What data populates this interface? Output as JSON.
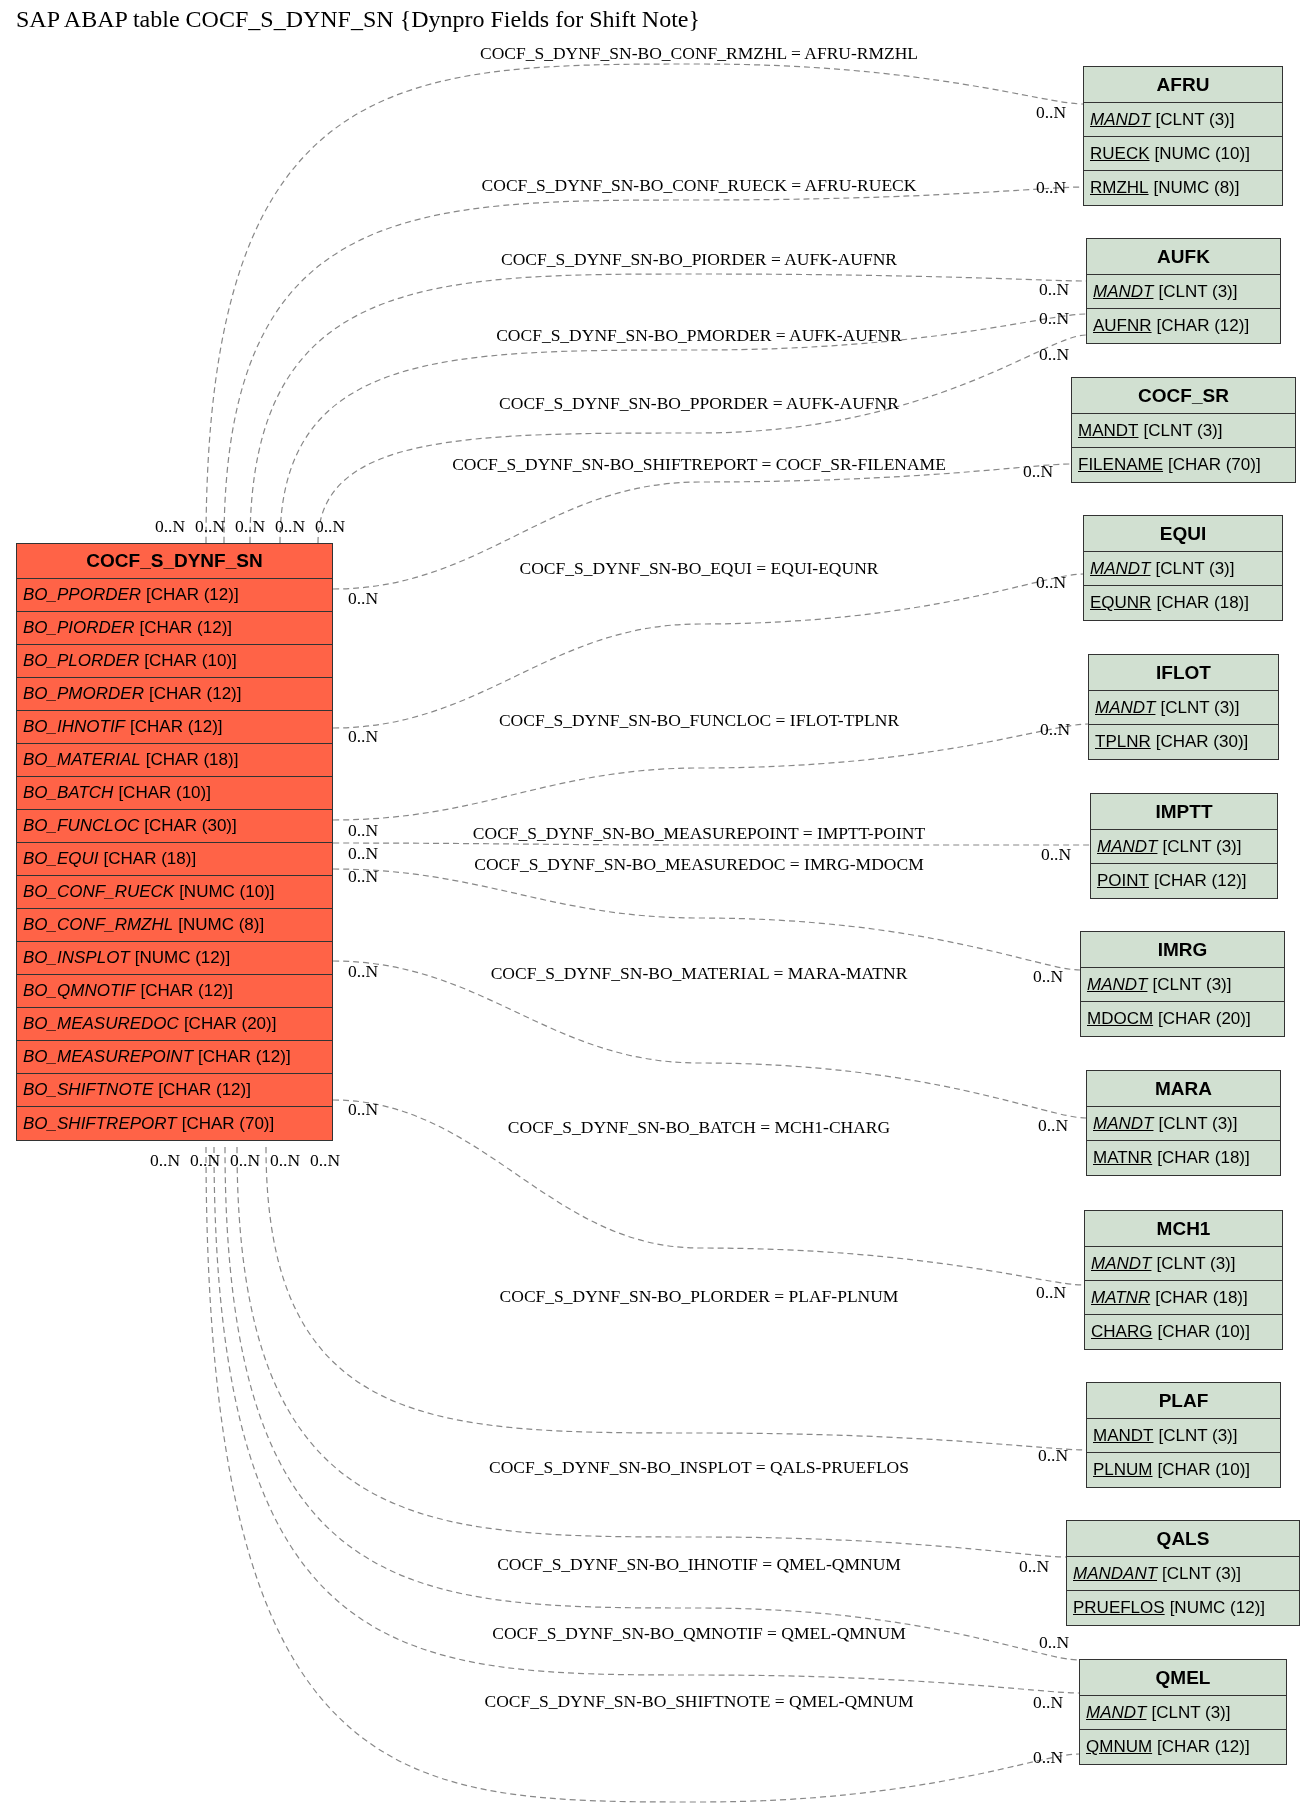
{
  "title": "SAP ABAP table COCF_S_DYNF_SN {Dynpro Fields for Shift Note}",
  "tables": [
    {
      "kind": "main",
      "name": "COCF_S_DYNF_SN",
      "fields": [
        {
          "name": "BO_PPORDER",
          "type": "[CHAR (12)]",
          "key": false,
          "italic": true
        },
        {
          "name": "BO_PIORDER",
          "type": "[CHAR (12)]",
          "key": false,
          "italic": true
        },
        {
          "name": "BO_PLORDER",
          "type": "[CHAR (10)]",
          "key": false,
          "italic": true
        },
        {
          "name": "BO_PMORDER",
          "type": "[CHAR (12)]",
          "key": false,
          "italic": true
        },
        {
          "name": "BO_IHNOTIF",
          "type": "[CHAR (12)]",
          "key": false,
          "italic": true
        },
        {
          "name": "BO_MATERIAL",
          "type": "[CHAR (18)]",
          "key": false,
          "italic": true
        },
        {
          "name": "BO_BATCH",
          "type": "[CHAR (10)]",
          "key": false,
          "italic": true
        },
        {
          "name": "BO_FUNCLOC",
          "type": "[CHAR (30)]",
          "key": false,
          "italic": true
        },
        {
          "name": "BO_EQUI",
          "type": "[CHAR (18)]",
          "key": false,
          "italic": true
        },
        {
          "name": "BO_CONF_RUECK",
          "type": "[NUMC (10)]",
          "key": false,
          "italic": true
        },
        {
          "name": "BO_CONF_RMZHL",
          "type": "[NUMC (8)]",
          "key": false,
          "italic": true
        },
        {
          "name": "BO_INSPLOT",
          "type": "[NUMC (12)]",
          "key": false,
          "italic": true
        },
        {
          "name": "BO_QMNOTIF",
          "type": "[CHAR (12)]",
          "key": false,
          "italic": true
        },
        {
          "name": "BO_MEASUREDOC",
          "type": "[CHAR (20)]",
          "key": false,
          "italic": true
        },
        {
          "name": "BO_MEASUREPOINT",
          "type": "[CHAR (12)]",
          "key": false,
          "italic": true
        },
        {
          "name": "BO_SHIFTNOTE",
          "type": "[CHAR (12)]",
          "key": false,
          "italic": true
        },
        {
          "name": "BO_SHIFTREPORT",
          "type": "[CHAR (70)]",
          "key": false,
          "italic": true
        }
      ]
    },
    {
      "kind": "related",
      "name": "AFRU",
      "fields": [
        {
          "name": "MANDT",
          "type": "[CLNT (3)]",
          "key": true,
          "italic": true
        },
        {
          "name": "RUECK",
          "type": "[NUMC (10)]",
          "key": true,
          "italic": false
        },
        {
          "name": "RMZHL",
          "type": "[NUMC (8)]",
          "key": true,
          "italic": false
        }
      ]
    },
    {
      "kind": "related",
      "name": "AUFK",
      "fields": [
        {
          "name": "MANDT",
          "type": "[CLNT (3)]",
          "key": true,
          "italic": true
        },
        {
          "name": "AUFNR",
          "type": "[CHAR (12)]",
          "key": true,
          "italic": false
        }
      ]
    },
    {
      "kind": "related",
      "name": "COCF_SR",
      "fields": [
        {
          "name": "MANDT",
          "type": "[CLNT (3)]",
          "key": true,
          "italic": false
        },
        {
          "name": "FILENAME",
          "type": "[CHAR (70)]",
          "key": true,
          "italic": false
        }
      ]
    },
    {
      "kind": "related",
      "name": "EQUI",
      "fields": [
        {
          "name": "MANDT",
          "type": "[CLNT (3)]",
          "key": true,
          "italic": true
        },
        {
          "name": "EQUNR",
          "type": "[CHAR (18)]",
          "key": true,
          "italic": false
        }
      ]
    },
    {
      "kind": "related",
      "name": "IFLOT",
      "fields": [
        {
          "name": "MANDT",
          "type": "[CLNT (3)]",
          "key": true,
          "italic": true
        },
        {
          "name": "TPLNR",
          "type": "[CHAR (30)]",
          "key": true,
          "italic": false
        }
      ]
    },
    {
      "kind": "related",
      "name": "IMPTT",
      "fields": [
        {
          "name": "MANDT",
          "type": "[CLNT (3)]",
          "key": true,
          "italic": true
        },
        {
          "name": "POINT",
          "type": "[CHAR (12)]",
          "key": true,
          "italic": false
        }
      ]
    },
    {
      "kind": "related",
      "name": "IMRG",
      "fields": [
        {
          "name": "MANDT",
          "type": "[CLNT (3)]",
          "key": true,
          "italic": true
        },
        {
          "name": "MDOCM",
          "type": "[CHAR (20)]",
          "key": true,
          "italic": false
        }
      ]
    },
    {
      "kind": "related",
      "name": "MARA",
      "fields": [
        {
          "name": "MANDT",
          "type": "[CLNT (3)]",
          "key": true,
          "italic": true
        },
        {
          "name": "MATNR",
          "type": "[CHAR (18)]",
          "key": true,
          "italic": false
        }
      ]
    },
    {
      "kind": "related",
      "name": "MCH1",
      "fields": [
        {
          "name": "MANDT",
          "type": "[CLNT (3)]",
          "key": true,
          "italic": true
        },
        {
          "name": "MATNR",
          "type": "[CHAR (18)]",
          "key": true,
          "italic": true
        },
        {
          "name": "CHARG",
          "type": "[CHAR (10)]",
          "key": true,
          "italic": false
        }
      ]
    },
    {
      "kind": "related",
      "name": "PLAF",
      "fields": [
        {
          "name": "MANDT",
          "type": "[CLNT (3)]",
          "key": true,
          "italic": false
        },
        {
          "name": "PLNUM",
          "type": "[CHAR (10)]",
          "key": true,
          "italic": false
        }
      ]
    },
    {
      "kind": "related",
      "name": "QALS",
      "fields": [
        {
          "name": "MANDANT",
          "type": "[CLNT (3)]",
          "key": true,
          "italic": true
        },
        {
          "name": "PRUEFLOS",
          "type": "[NUMC (12)]",
          "key": true,
          "italic": false
        }
      ]
    },
    {
      "kind": "related",
      "name": "QMEL",
      "fields": [
        {
          "name": "MANDT",
          "type": "[CLNT (3)]",
          "key": true,
          "italic": true
        },
        {
          "name": "QMNUM",
          "type": "[CHAR (12)]",
          "key": true,
          "italic": false
        }
      ]
    }
  ],
  "relations": [
    {
      "label": "COCF_S_DYNF_SN-BO_CONF_RMZHL = AFRU-RMZHL",
      "from_card": "0..N",
      "to_card": "0..N"
    },
    {
      "label": "COCF_S_DYNF_SN-BO_CONF_RUECK = AFRU-RUECK",
      "from_card": "0..N",
      "to_card": "0..N"
    },
    {
      "label": "COCF_S_DYNF_SN-BO_PIORDER = AUFK-AUFNR",
      "from_card": "0..N",
      "to_card": "0..N"
    },
    {
      "label": "COCF_S_DYNF_SN-BO_PMORDER = AUFK-AUFNR",
      "from_card": "0..N",
      "to_card": "0..N"
    },
    {
      "label": "COCF_S_DYNF_SN-BO_PPORDER = AUFK-AUFNR",
      "from_card": "0..N",
      "to_card": "0..N"
    },
    {
      "label": "COCF_S_DYNF_SN-BO_SHIFTREPORT = COCF_SR-FILENAME",
      "from_card": "0..N",
      "to_card": "0..N"
    },
    {
      "label": "COCF_S_DYNF_SN-BO_EQUI = EQUI-EQUNR",
      "from_card": "0..N",
      "to_card": "0..N"
    },
    {
      "label": "COCF_S_DYNF_SN-BO_FUNCLOC = IFLOT-TPLNR",
      "from_card": "0..N",
      "to_card": "0..N"
    },
    {
      "label": "COCF_S_DYNF_SN-BO_MEASUREPOINT = IMPTT-POINT",
      "from_card": "0..N",
      "to_card": "0..N"
    },
    {
      "label": "COCF_S_DYNF_SN-BO_MEASUREDOC = IMRG-MDOCM",
      "from_card": "0..N",
      "to_card": "0..N"
    },
    {
      "label": "COCF_S_DYNF_SN-BO_MATERIAL = MARA-MATNR",
      "from_card": "0..N",
      "to_card": "0..N"
    },
    {
      "label": "COCF_S_DYNF_SN-BO_BATCH = MCH1-CHARG",
      "from_card": "0..N",
      "to_card": "0..N"
    },
    {
      "label": "COCF_S_DYNF_SN-BO_PLORDER = PLAF-PLNUM",
      "from_card": "0..N",
      "to_card": "0..N"
    },
    {
      "label": "COCF_S_DYNF_SN-BO_INSPLOT = QALS-PRUEFLOS",
      "from_card": "0..N",
      "to_card": "0..N"
    },
    {
      "label": "COCF_S_DYNF_SN-BO_IHNOTIF = QMEL-QMNUM",
      "from_card": "0..N",
      "to_card": "0..N"
    },
    {
      "label": "COCF_S_DYNF_SN-BO_QMNOTIF = QMEL-QMNUM",
      "from_card": "0..N",
      "to_card": "0..N"
    },
    {
      "label": "COCF_S_DYNF_SN-BO_SHIFTNOTE = QMEL-QMNUM",
      "from_card": "0..N",
      "to_card": "0..N"
    }
  ]
}
